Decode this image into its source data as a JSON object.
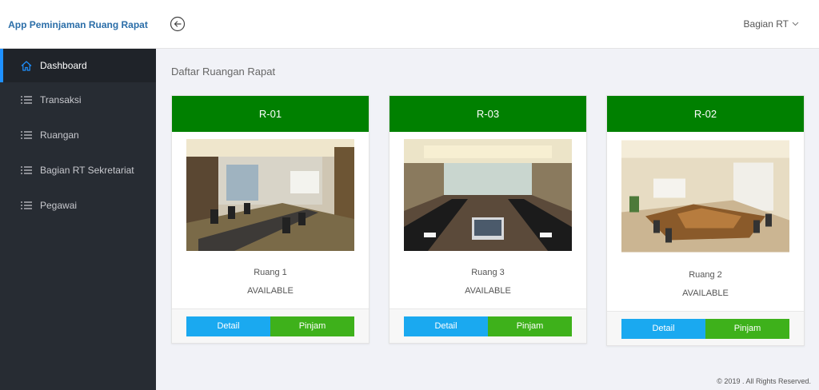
{
  "app": {
    "title": "App Peminjaman Ruang Rapat"
  },
  "header": {
    "user_label": "Bagian RT"
  },
  "sidebar": {
    "items": [
      {
        "label": "Dashboard",
        "icon": "home-icon",
        "active": true
      },
      {
        "label": "Transaksi",
        "icon": "list-icon"
      },
      {
        "label": "Ruangan",
        "icon": "list-icon"
      },
      {
        "label": "Bagian RT Sekretariat",
        "icon": "list-icon"
      },
      {
        "label": "Pegawai",
        "icon": "list-icon"
      }
    ]
  },
  "main": {
    "title": "Daftar Ruangan Rapat",
    "rooms": [
      {
        "code": "R-01",
        "name": "Ruang 1",
        "status": "AVAILABLE",
        "detail_label": "Detail",
        "borrow_label": "Pinjam"
      },
      {
        "code": "R-03",
        "name": "Ruang 3",
        "status": "AVAILABLE",
        "detail_label": "Detail",
        "borrow_label": "Pinjam"
      },
      {
        "code": "R-02",
        "name": "Ruang 2",
        "status": "AVAILABLE",
        "detail_label": "Detail",
        "borrow_label": "Pinjam"
      }
    ]
  },
  "footer": {
    "text": "© 2019 . All Rights Reserved."
  },
  "colors": {
    "card_header": "#008000",
    "detail_button": "#1aa9f0",
    "borrow_button": "#3eb11b",
    "sidebar": "#272c33",
    "brand": "#2b6ea8"
  }
}
